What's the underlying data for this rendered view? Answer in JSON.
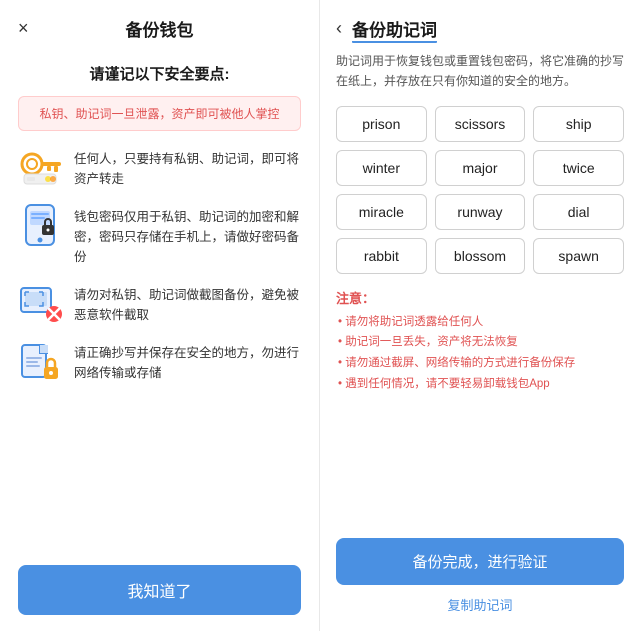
{
  "left": {
    "close_label": "×",
    "title": "备份钱包",
    "safety_title": "请谨记以下安全要点:",
    "warning": "私钥、助记词一旦泄露，资产即可被他人掌控",
    "items": [
      {
        "id": "key",
        "text": "任何人，只要持有私钥、助记词，即可将资产转走"
      },
      {
        "id": "phone",
        "text": "钱包密码仅用于私钥、助记词的加密和解密，密码只存储在手机上，请做好密码备份"
      },
      {
        "id": "screenshot",
        "text": "请勿对私钥、助记词做截图备份，避免被恶意软件截取"
      },
      {
        "id": "safe",
        "text": "请正确抄写并保存在安全的地方，勿进行网络传输或存储"
      }
    ],
    "btn_know": "我知道了"
  },
  "right": {
    "back_label": "‹",
    "title": "备份助记词",
    "desc": "助记词用于恢复钱包或重置钱包密码，将它准确的抄写在纸上，并存放在只有你知道的安全的地方。",
    "mnemonic_words": [
      "prison",
      "scissors",
      "ship",
      "winter",
      "major",
      "twice",
      "miracle",
      "runway",
      "dial",
      "rabbit",
      "blossom",
      "spawn"
    ],
    "notes_title": "注意：",
    "notes": [
      "请勿将助记词透露给任何人",
      "助记词一旦丢失，资产将无法恢复",
      "请勿通过截屏、网络传输的方式进行备份保存",
      "遇到任何情况，请不要轻易卸载钱包App"
    ],
    "btn_verify": "备份完成，进行验证",
    "btn_copy": "复制助记词"
  }
}
